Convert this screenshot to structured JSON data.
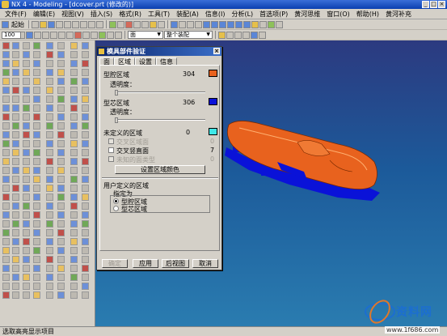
{
  "window": {
    "title": "NX 4 - Modeling - [dcover.prt (修改的)]",
    "controls": [
      "_",
      "□",
      "×"
    ]
  },
  "menubar": {
    "items": [
      "文件(F)",
      "编辑(E)",
      "视图(V)",
      "插入(S)",
      "格式(R)",
      "工具(T)",
      "装配(A)",
      "信息(I)",
      "分析(L)",
      "首选项(P)",
      "黄河思维",
      "窗口(O)",
      "帮助(H)",
      "黄河补充"
    ]
  },
  "toolbar1": {
    "app_label": "起始"
  },
  "toolbar2": {
    "combo_face": "面",
    "combo_feature": "整个装配"
  },
  "toolbar3": {
    "zoom": "100"
  },
  "statusbar": {
    "text": "选取高亮显示项目"
  },
  "dialog": {
    "title": "模具部件验证",
    "close": "×",
    "tabs": [
      "面",
      "区域",
      "设置",
      "信息"
    ],
    "active_tab": 1,
    "cavity": {
      "label": "型腔区域",
      "count": "304",
      "transparency_label": "透明度：",
      "color": "#e8621e",
      "transparency": 0
    },
    "core": {
      "label": "型芯区域",
      "count": "306",
      "transparency_label": "透明度：",
      "color": "#0a12d8",
      "transparency": 0
    },
    "undefined": {
      "label": "未定义的区域",
      "count": "0",
      "color": "#3fe8e8"
    },
    "checkboxes": [
      {
        "label": "交叉区域面",
        "count": "0",
        "enabled": false,
        "checked": false
      },
      {
        "label": "交叉竖直面",
        "count": "7",
        "enabled": true,
        "checked": false
      },
      {
        "label": "未知的面类型",
        "count": "0",
        "enabled": false,
        "checked": false
      }
    ],
    "set_color_button": "设置区域颜色",
    "user_defined": {
      "label": "用户定义的区域",
      "assign_label": "指定为",
      "options": [
        "型腔区域",
        "型芯区域"
      ],
      "selected": 0
    },
    "buttons": {
      "ok": "确定",
      "apply": "应用",
      "back": "后视图",
      "cancel": "取消"
    }
  },
  "watermark": {
    "brand": "资料网",
    "url": "www.1f686.com"
  }
}
